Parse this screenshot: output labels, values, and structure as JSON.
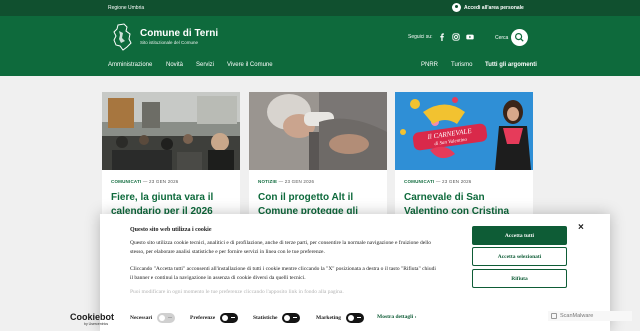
{
  "topbar": {
    "region": "Regione Umbria",
    "login": "Accedi all'area personale"
  },
  "header": {
    "title": "Comune di Terni",
    "subtitle": "Sito istituzionale del Comune",
    "follow_label": "Seguici su:",
    "search_label": "Cerca",
    "accent_color": "#0e6a3c"
  },
  "nav": {
    "left": [
      "Amministrazione",
      "Novità",
      "Servizi",
      "Vivere il Comune"
    ],
    "right": [
      "PNRR",
      "Turismo",
      "Tutti gli argomenti"
    ]
  },
  "cards": [
    {
      "category": "COMUNICATI",
      "date": "23 GEN 2026",
      "title": "Fiere, la giunta vara il calendario per il 2026"
    },
    {
      "category": "NOTIZIE",
      "date": "23 GEN 2026",
      "title": "Con il progetto Alt il Comune protegge gli"
    },
    {
      "category": "COMUNICATI",
      "date": "23 GEN 2026",
      "title": "Carnevale di San Valentino con Cristina",
      "image_text": [
        "Il CARNEVALE",
        "di San Valentino"
      ]
    }
  ],
  "cookie": {
    "heading": "Questo sito web utilizza i cookie",
    "p1": "Questo sito utilizza cookie tecnici, analitici e di profilazione, anche di terze parti, per consentire la normale navigazione e fruizione dello stesso, per elaborare analisi statistiche e per fornire servizi in linea con le tue preferenze.",
    "p2": "Cliccando \"Accetta tutti\" acconsenti all'installazione di tutti i cookie mentre cliccando la \"X\" posizionata a destra o il tasto \"Rifiuta\" chiudi il banner e continui la navigazione in assenza di cookie diversi da quelli tecnici.",
    "p3": "Puoi modificare in ogni momento le tue preferenze cliccando l'apposito link in fondo alla pagina.",
    "accept_all": "Accetta tutti",
    "accept_selected": "Accetta selezionati",
    "reject": "Rifiuta",
    "close": "×",
    "toggles": [
      "Necessari",
      "Preferenze",
      "Statistiche",
      "Marketing"
    ],
    "details": "Mostra dettagli",
    "brand": "Cookiebot",
    "brand_sub": "by Usercentrics"
  },
  "badge": {
    "label": "ScanMalware"
  }
}
